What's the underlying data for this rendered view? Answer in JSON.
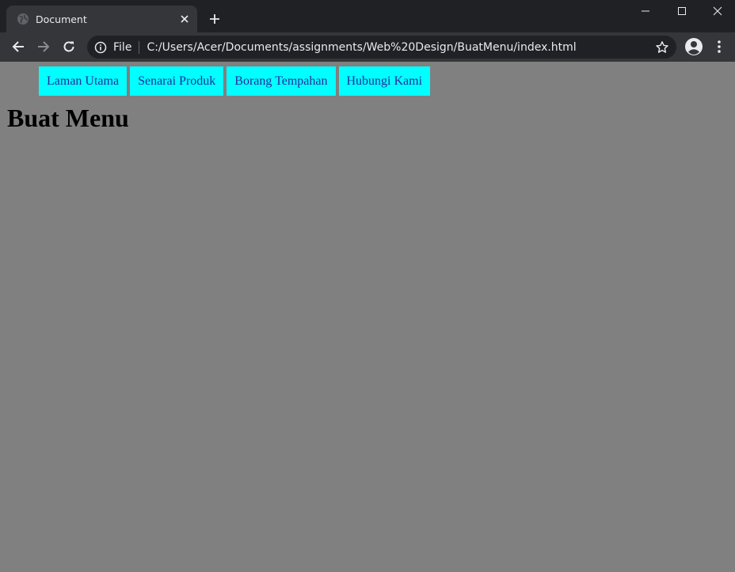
{
  "browser": {
    "tab_title": "Document",
    "address_scheme": "File",
    "address_url": "C:/Users/Acer/Documents/assignments/Web%20Design/BuatMenu/index.html",
    "icons": [
      "globe-icon",
      "close-icon",
      "plus-icon",
      "minimize-icon",
      "maximize-icon",
      "window-close-icon",
      "back-arrow-icon",
      "forward-arrow-icon",
      "reload-icon",
      "info-icon",
      "star-icon",
      "profile-icon",
      "more-vert-icon"
    ]
  },
  "page": {
    "background": "#808080",
    "nav_background": "#00ffff",
    "nav_text_color": "#2a2aa0",
    "nav": {
      "items": [
        {
          "label": "Laman Utama"
        },
        {
          "label": "Senarai Produk"
        },
        {
          "label": "Borang Tempahan"
        },
        {
          "label": "Hubungi Kami"
        }
      ]
    },
    "heading": "Buat Menu"
  }
}
